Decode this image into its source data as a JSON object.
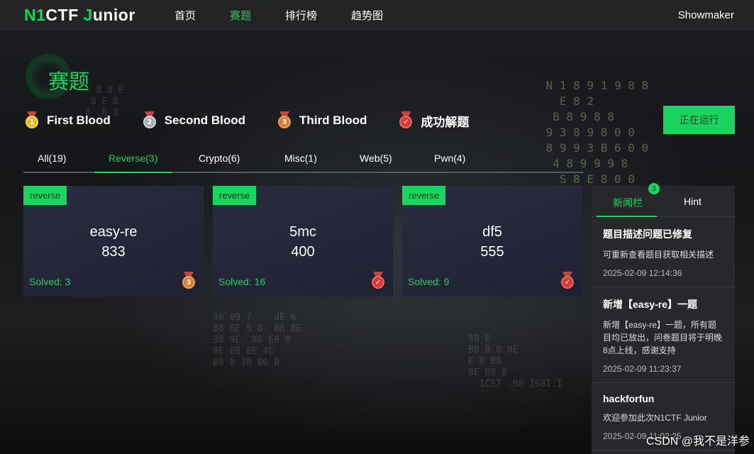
{
  "app": {
    "logo_n1": "N1",
    "logo_ctf": "CTF ",
    "logo_j": "J",
    "logo_rest": "unior"
  },
  "nav": {
    "items": [
      {
        "label": "首页",
        "active": false
      },
      {
        "label": "赛题",
        "active": true
      },
      {
        "label": "排行榜",
        "active": false
      },
      {
        "label": "趋势图",
        "active": false
      }
    ],
    "user": "Showmaker"
  },
  "page": {
    "title": "赛题",
    "run_button": "正在运行"
  },
  "legend": [
    {
      "icon": "gold-medal-icon",
      "number": "1",
      "label": "First Blood"
    },
    {
      "icon": "silver-medal-icon",
      "number": "2",
      "label": "Second Blood"
    },
    {
      "icon": "bronze-medal-icon",
      "number": "3",
      "label": "Third Blood"
    },
    {
      "icon": "solved-check-medal-icon",
      "number": "✓",
      "label": "成功解题"
    }
  ],
  "tabs": [
    {
      "label": "All(19)",
      "active": false
    },
    {
      "label": "Reverse(3)",
      "active": true
    },
    {
      "label": "Crypto(6)",
      "active": false
    },
    {
      "label": "Misc(1)",
      "active": false
    },
    {
      "label": "Web(5)",
      "active": false
    },
    {
      "label": "Pwn(4)",
      "active": false
    }
  ],
  "challenges": [
    {
      "tag": "reverse",
      "name": "easy-re",
      "score": "833",
      "solved": "Solved: 3",
      "medal": "bronze-medal-icon",
      "medal_text": "3"
    },
    {
      "tag": "reverse",
      "name": "5mc",
      "score": "400",
      "solved": "Solved: 16",
      "medal": "solved-check-medal-icon",
      "medal_text": "✓"
    },
    {
      "tag": "reverse",
      "name": "df5",
      "score": "555",
      "solved": "Solved: 9",
      "medal": "solved-check-medal-icon",
      "medal_text": "✓"
    }
  ],
  "news": {
    "tab_news": "新闻栏",
    "tab_hint": "Hint",
    "badge": "3",
    "entries": [
      {
        "title": "题目描述问题已修复",
        "body": "可重新查看题目获取相关描述",
        "date": "2025-02-09 12:14:36"
      },
      {
        "title": "新增【easy-re】一题",
        "body": "新增【easy-re】一题，所有题目均已放出，问卷题目将于明晚8点上线，感谢支持",
        "date": "2025-02-09 11:23:37"
      },
      {
        "title": "hackforfun",
        "body": "欢迎参加此次N1CTF Junior",
        "date": "2025-02-09 11:02:25"
      }
    ]
  },
  "watermark": "CSDN @我不是洋参",
  "colors": {
    "accent": "#19d45f",
    "nav_bg": "#222426",
    "card_bg": "#23253a",
    "panel_bg": "#26282b"
  }
}
